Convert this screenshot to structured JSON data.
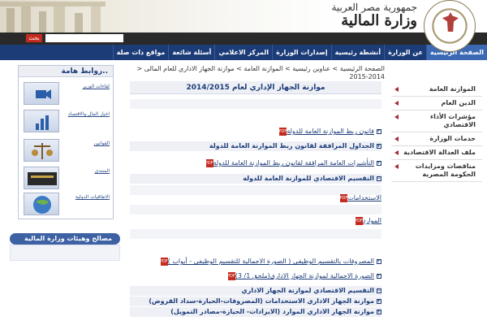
{
  "header": {
    "republic": "جمهورية مصر العربية",
    "ministry": "وزارة المالية",
    "search_button": "بحث"
  },
  "nav": [
    {
      "label": "الصفحة الرئيسية",
      "active": true
    },
    {
      "label": "عن الوزارة"
    },
    {
      "label": "أنشطة رئيسية"
    },
    {
      "label": "إصدارات الوزارة"
    },
    {
      "label": "المركز الاعلامي"
    },
    {
      "label": "أسئلة شائعة"
    },
    {
      "label": "مواقع ذات صلة"
    }
  ],
  "breadcrumb": "> الصفحة الرئيسية > عناوين رئيسية > الموازنة العامة > موازنة الجهاز الاداري للعام المالى 2014-2015",
  "page_title": "موازنة الجهاز الإداري لعام 2014/2015",
  "content": {
    "r1": "قانون ربط الموازنة العامة للدولة",
    "r2": "الجداول المرافقة لقانون ربط الموازنة العامة للدولة",
    "r3": "التأشيرات العامة المرافقة لقانون ربط الموازنة العامة للدولة",
    "r4": "التقسيم الاقتصادي للموازنة العامة للدولة",
    "r5": "الاستخدامات",
    "r6": "الموارد",
    "r7": "المصروفات بالتقسيم الوظيفى ( الصورة الاجمالية للتقسيم الوظيفى - أبواب )",
    "r8": "الصورة الاجمالية لموازنة الجهاز الادارى(ملحق 1/ 3)",
    "r9": "التقسيم الاقتصادي لموازنة الجهاز الاداري",
    "r10": "موازنة الجهاز الاداري الاستخدامات (المصروفات-الحيازة-سداد القروض)",
    "r11": "موازنة الجهاز الاداري الموارد (الايرادات- الحيازة-مصادر التمويل)"
  },
  "sidebar": [
    "الموازنة العامة",
    "الدين العام",
    "مؤشرات الأداء الاقتصادي",
    "خدمات الوزارة",
    "ملف العدالة الاقتصادية",
    "مناقصات ومزايدات الحكومة المصرية"
  ],
  "useful_links": {
    "title": "روابط هامة..",
    "items": [
      "لقاءات الوزير",
      "اخبار المال والاقتصاد",
      "القوانين",
      "المنتدى",
      "الاتفاقيات الدولية"
    ]
  },
  "bottom_box": "مصالح وهيئات وزارة المالية"
}
